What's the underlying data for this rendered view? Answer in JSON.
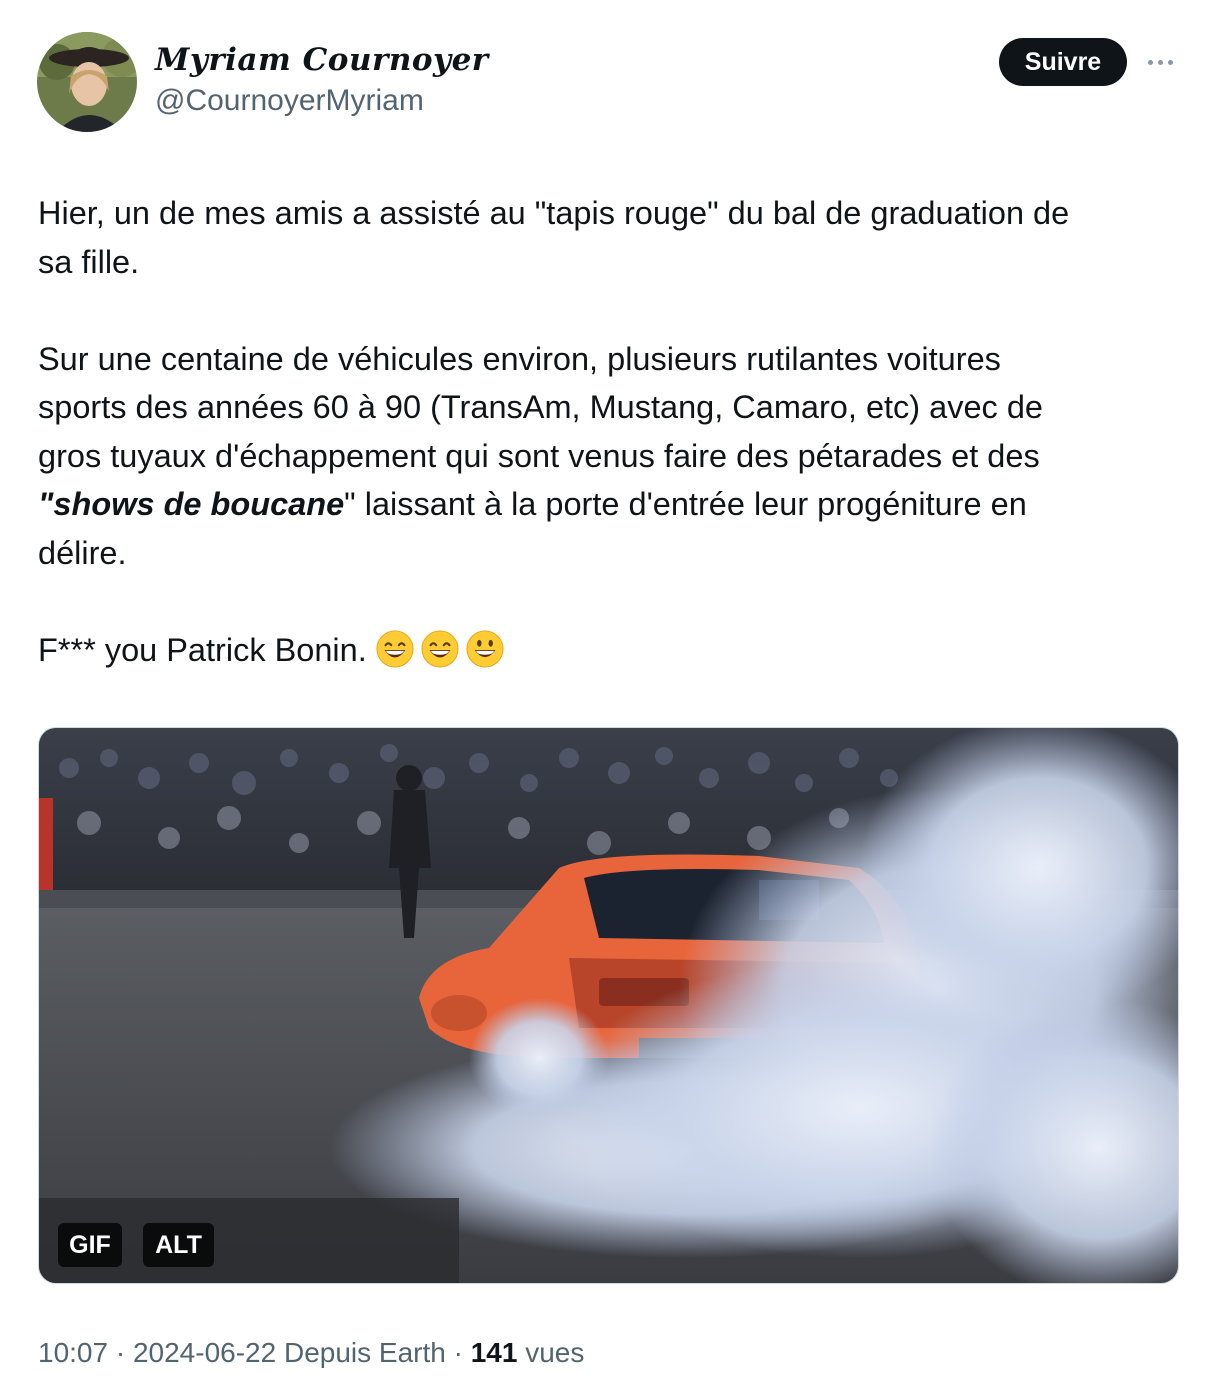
{
  "author": {
    "display_name": "Myriam Cournoyer",
    "handle": "@CournoyerMyriam"
  },
  "actions": {
    "follow_label": "Suivre"
  },
  "tweet": {
    "para1_line1": "Hier, un de mes amis a assisté au \"tapis rouge\" du bal de graduation de",
    "para1_line2": "sa fille.",
    "para2_line1": "Sur une centaine de véhicules environ, plusieurs rutilantes voitures",
    "para2_line2": "sports des années 60 à 90 (TransAm, Mustang, Camaro, etc) avec de",
    "para2_line3": "gros tuyaux d'échappement qui sont venus faire des pétarades et des",
    "para2_line4_bold": "\"shows de boucane",
    "para2_line4_rest": "\" laissant à la porte d'entrée leur progéniture en",
    "para2_line5": "délire.",
    "para3_text": "F*** you Patrick Bonin. ",
    "emojis": [
      "grinning-face-with-smiling-eyes",
      "grinning-face-with-smiling-eyes",
      "grinning-face"
    ]
  },
  "media": {
    "gif_badge": "GIF",
    "alt_badge": "ALT"
  },
  "meta": {
    "time": "10:07",
    "sep1": " · ",
    "date": "2024-06-22",
    "source": " Depuis Earth",
    "sep2": " · ",
    "views_count": "141",
    "views_label": " vues"
  },
  "colors": {
    "text": "#0f1419",
    "secondary": "#536471",
    "follow_bg": "#0f1419",
    "car": "#e8643a"
  }
}
